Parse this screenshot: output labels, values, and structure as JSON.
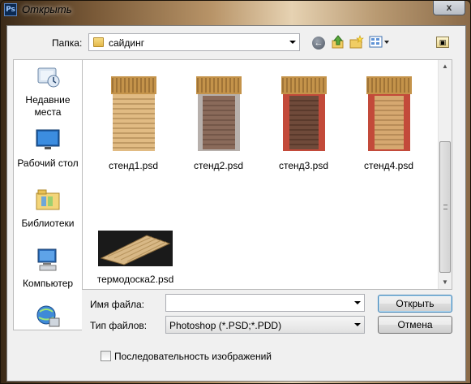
{
  "window": {
    "app_icon_text": "Ps",
    "title": "Открыть",
    "close_glyph": "x"
  },
  "toolbar": {
    "folder_label": "Папка:",
    "folder_value": "сайдинг"
  },
  "places": [
    {
      "label_line1": "Недавние",
      "label_line2": "места",
      "icon": "recent-places-icon"
    },
    {
      "label_line1": "Рабочий стол",
      "label_line2": "",
      "icon": "desktop-icon"
    },
    {
      "label_line1": "Библиотеки",
      "label_line2": "",
      "icon": "libraries-icon"
    },
    {
      "label_line1": "Компьютер",
      "label_line2": "",
      "icon": "computer-icon"
    },
    {
      "label_line1": "",
      "label_line2": "",
      "icon": "network-icon"
    }
  ],
  "files": [
    {
      "name": "стенд1.psd",
      "board_color": "#d9b27a",
      "side_color": "#e6c48e"
    },
    {
      "name": "стенд2.psd",
      "board_color": "#8a6a5a",
      "side_color": "#a08070"
    },
    {
      "name": "стенд3.psd",
      "board_color": "#6f4a3a",
      "side_color": "#c34a3a"
    },
    {
      "name": "стенд4.psd",
      "board_color": "#d6a870",
      "side_color": "#c34a3a"
    },
    {
      "name": "термодоска2.psd",
      "board_color": "#d8b886",
      "side_color": "#222"
    }
  ],
  "filename": {
    "label": "Имя файла:",
    "value": ""
  },
  "filetype": {
    "label": "Тип файлов:",
    "value": "Photoshop (*.PSD;*.PDD)"
  },
  "buttons": {
    "open": "Открыть",
    "cancel": "Отмена"
  },
  "sequence": {
    "label": "Последовательность изображений",
    "checked": false
  }
}
